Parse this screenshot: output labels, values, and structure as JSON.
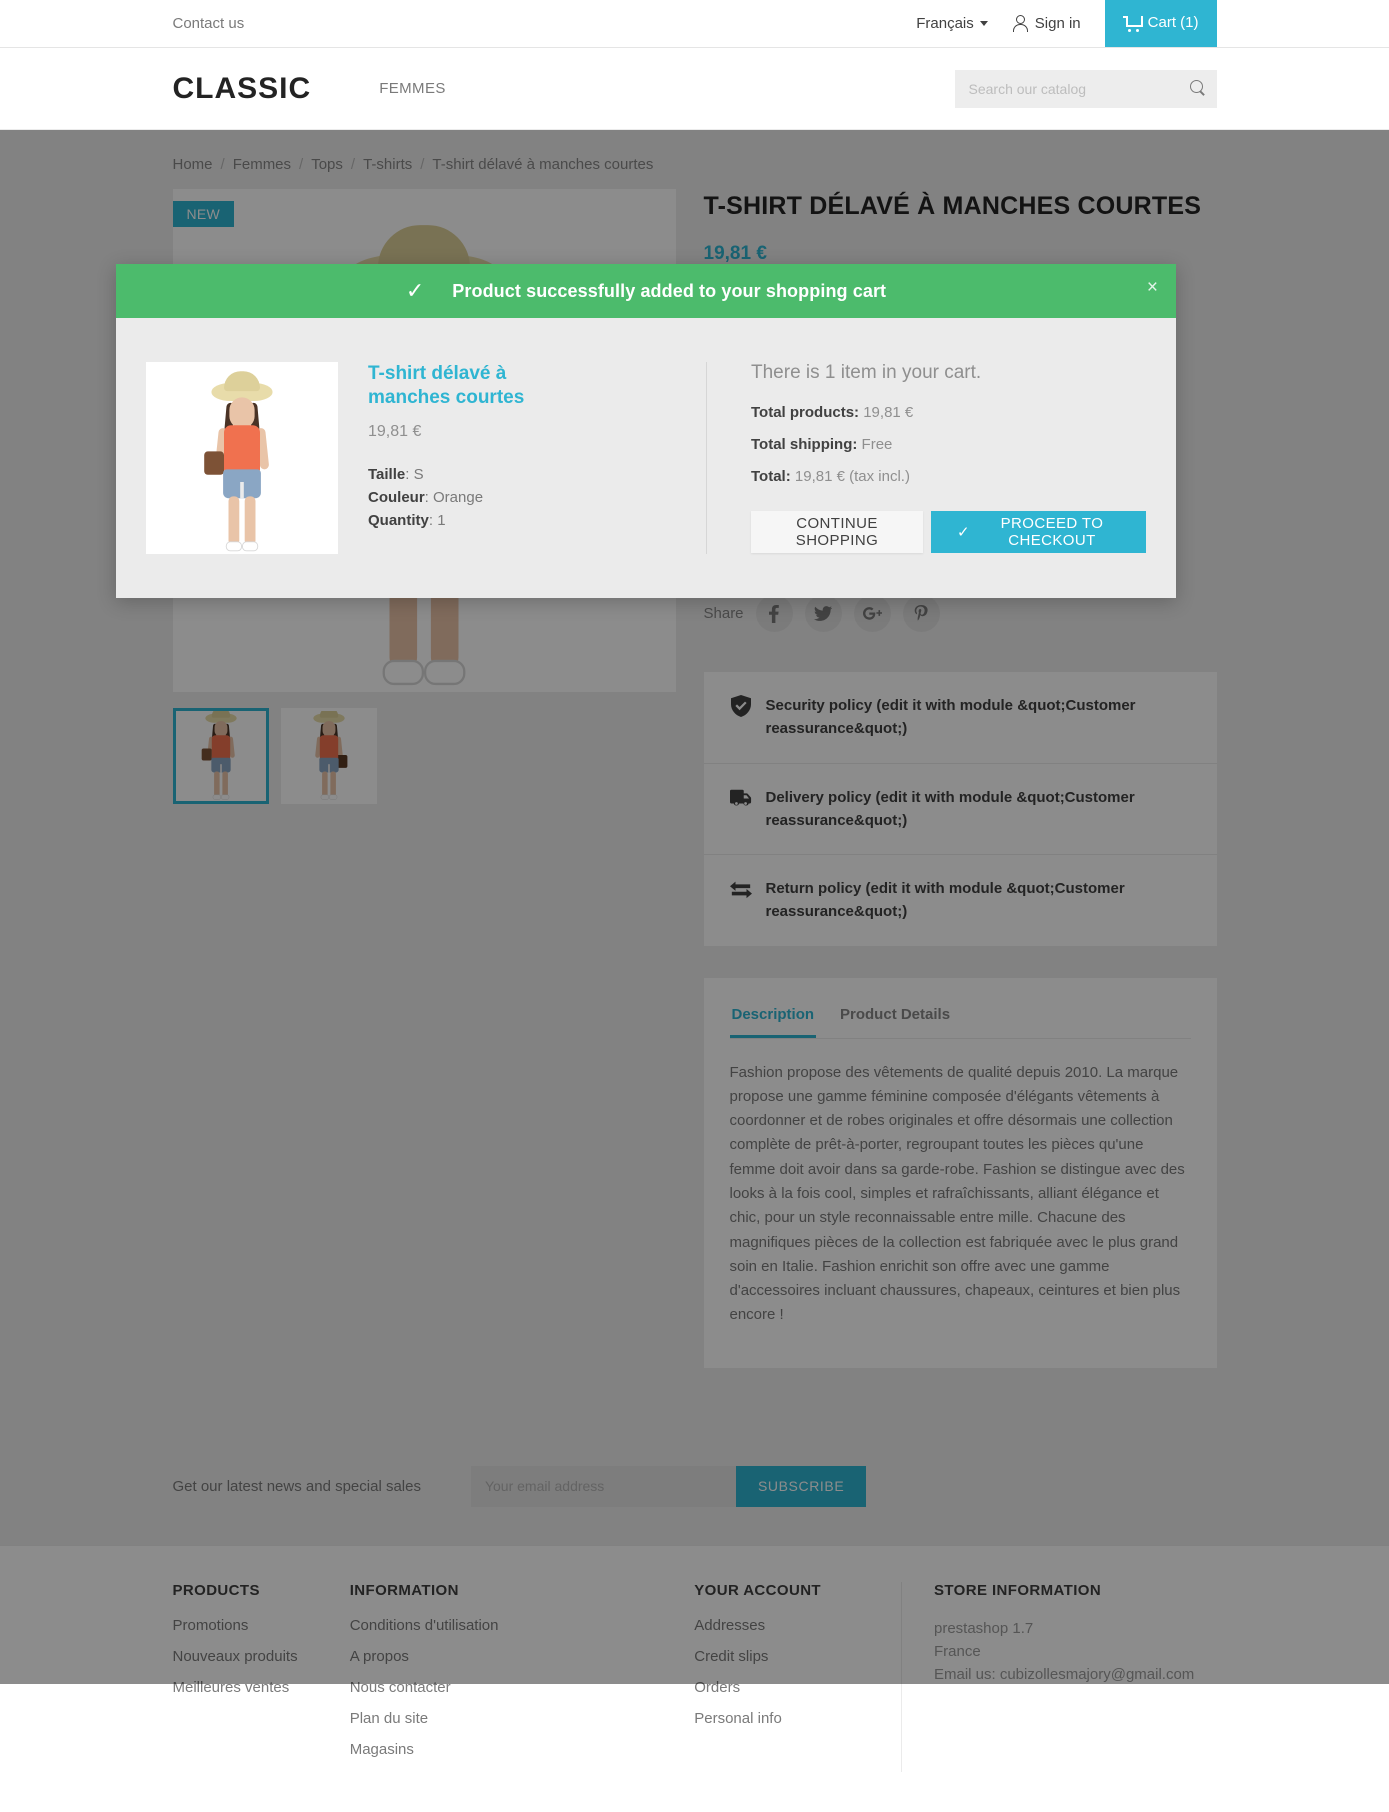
{
  "topbar": {
    "contact_label": "Contact us",
    "language": "Français",
    "signin_label": "Sign in",
    "cart_label": "Cart (1)"
  },
  "header": {
    "logo": "CLASSIC",
    "menu": [
      {
        "label": "FEMMES"
      }
    ],
    "search_placeholder": "Search our catalog",
    "search_value": ""
  },
  "breadcrumb": [
    {
      "label": "Home"
    },
    {
      "label": "Femmes"
    },
    {
      "label": "Tops"
    },
    {
      "label": "T-shirts"
    },
    {
      "label": "T-shirt délavé à manches courtes"
    }
  ],
  "product": {
    "badge": "NEW",
    "title": "T-SHIRT DÉLAVÉ À MANCHES COURTES",
    "price": "19,81 €",
    "share_label": "Share",
    "social": [
      {
        "name": "facebook-icon",
        "glyph": "f"
      },
      {
        "name": "twitter-icon",
        "glyph": "ᴠ"
      },
      {
        "name": "google-plus-icon",
        "glyph": "G+"
      },
      {
        "name": "pinterest-icon",
        "glyph": "ᴘ"
      }
    ]
  },
  "policies": [
    {
      "icon": "shield-check-icon",
      "text": "Security policy (edit it with module &quot;Customer reassurance&quot;)"
    },
    {
      "icon": "truck-icon",
      "text": "Delivery policy (edit it with module &quot;Customer reassurance&quot;)"
    },
    {
      "icon": "return-arrows-icon",
      "text": "Return policy (edit it with module &quot;Customer reassurance&quot;)"
    }
  ],
  "tabs": {
    "items": [
      {
        "label": "Description",
        "active": true
      },
      {
        "label": "Product Details",
        "active": false
      }
    ],
    "description": "Fashion propose des vêtements de qualité depuis 2010. La marque propose une gamme féminine composée d'élégants vêtements à coordonner et de robes originales et offre désormais une collection complète de prêt-à-porter, regroupant toutes les pièces qu'une femme doit avoir dans sa garde-robe. Fashion se distingue avec des looks à la fois cool, simples et rafraîchissants, alliant élégance et chic, pour un style reconnaissable entre mille. Chacune des magnifiques pièces de la collection est fabriquée avec le plus grand soin en Italie. Fashion enrichit son offre avec une gamme d'accessoires incluant chaussures, chapeaux, ceintures et bien plus encore !"
  },
  "modal": {
    "header_text": "Product successfully added to your shopping cart",
    "close_label": "×",
    "product_name": "T-shirt délavé à manches courtes",
    "product_price": "19,81 €",
    "attr_size_label": "Taille",
    "attr_size_value": "S",
    "attr_color_label": "Couleur",
    "attr_color_value": "Orange",
    "attr_qty_label": "Quantity",
    "attr_qty_value": "1",
    "cart_count_text": "There is 1 item in your cart.",
    "total_products_label": "Total products:",
    "total_products_value": "19,81 €",
    "total_shipping_label": "Total shipping:",
    "total_shipping_value": "Free",
    "total_label": "Total:",
    "total_value": "19,81 € (tax incl.)",
    "continue_label": "CONTINUE SHOPPING",
    "checkout_label": "PROCEED TO CHECKOUT"
  },
  "newsletter": {
    "text": "Get our latest news and special sales",
    "placeholder": "Your email address",
    "value": "",
    "button": "SUBSCRIBE"
  },
  "footer": {
    "products": {
      "heading": "PRODUCTS",
      "links": [
        {
          "label": "Promotions"
        },
        {
          "label": "Nouveaux produits"
        },
        {
          "label": "Meilleures ventes"
        }
      ]
    },
    "information": {
      "heading": "INFORMATION",
      "links": [
        {
          "label": "Conditions d'utilisation"
        },
        {
          "label": "A propos"
        },
        {
          "label": "Nous contacter"
        },
        {
          "label": "Plan du site"
        },
        {
          "label": "Magasins"
        }
      ]
    },
    "account": {
      "heading": "YOUR ACCOUNT",
      "links": [
        {
          "label": "Addresses"
        },
        {
          "label": "Credit slips"
        },
        {
          "label": "Orders"
        },
        {
          "label": "Personal info"
        }
      ]
    },
    "store": {
      "heading": "STORE INFORMATION",
      "lines": [
        "prestashop 1.7",
        "France",
        "Email us: cubizollesmajory@gmail.com"
      ]
    }
  },
  "colors": {
    "accent": "#2fb5d2",
    "success": "#4cbb6c",
    "band": "#ededed",
    "text": "#7a7a7a",
    "heading": "#414141"
  }
}
